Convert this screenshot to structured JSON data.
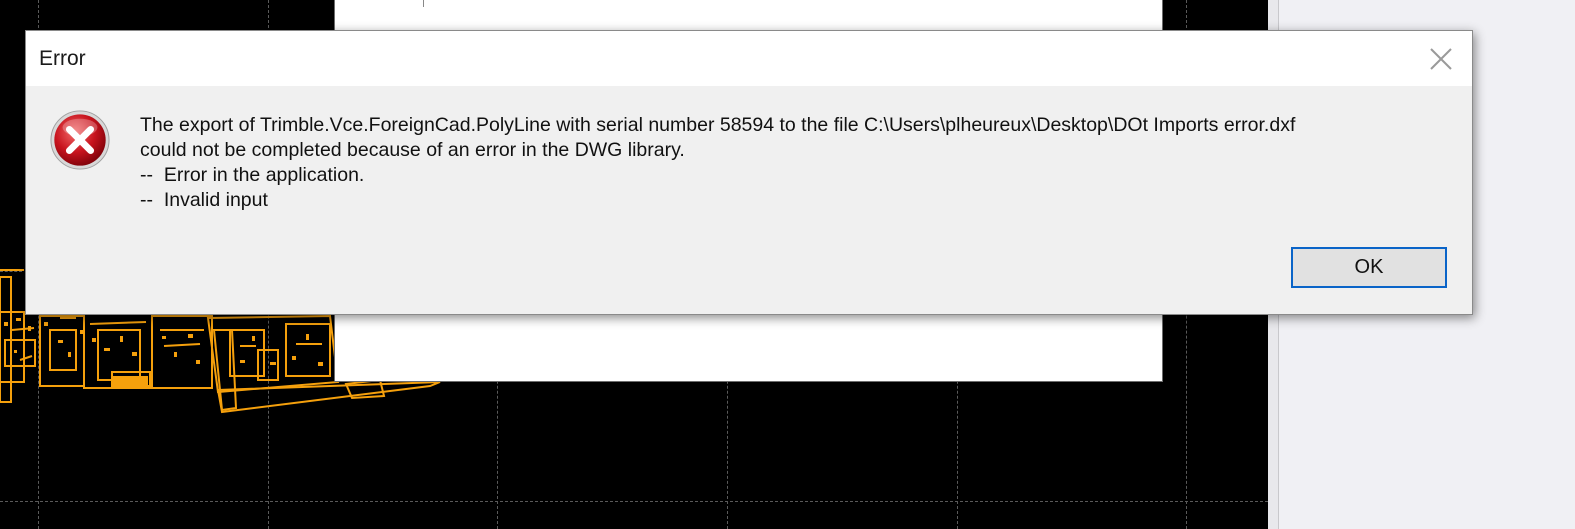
{
  "dialog": {
    "title": "Error",
    "message_lines": [
      "The export of Trimble.Vce.ForeignCad.PolyLine with serial number 58594 to the file C:\\Users\\plheureux\\Desktop\\DOt Imports error.dxf",
      "could not be completed because of an error in the DWG library.",
      "--  Error in the application.",
      "--  Invalid input"
    ],
    "ok_label": "OK",
    "icons": {
      "error": "error-circle-x-icon",
      "close": "close-x-icon"
    }
  },
  "colors": {
    "cad_background": "#000000",
    "cad_drawing": "#f5a00c",
    "dialog_background": "#f0f0f0",
    "titlebar": "#ffffff",
    "button_focus_border": "#0a64c8",
    "error_red": "#c8141e"
  }
}
